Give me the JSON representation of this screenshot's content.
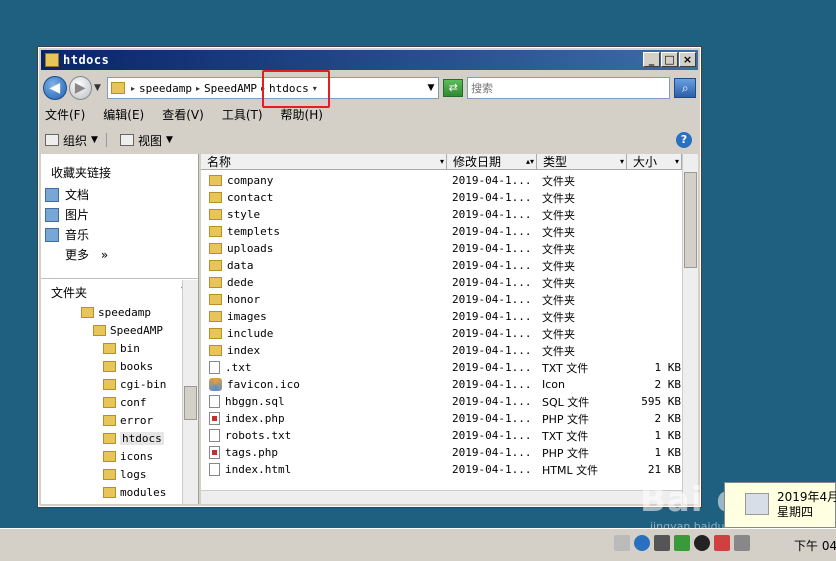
{
  "window": {
    "title": "htdocs"
  },
  "address": {
    "crumbs": [
      "speedamp",
      "SpeedAMP",
      "htdocs"
    ],
    "search_placeholder": "搜索"
  },
  "menu": [
    "文件(F)",
    "编辑(E)",
    "查看(V)",
    "工具(T)",
    "帮助(H)"
  ],
  "toolbar": {
    "organize": "组织",
    "view": "视图"
  },
  "favorites": {
    "title": "收藏夹链接",
    "items": [
      "文档",
      "图片",
      "音乐"
    ],
    "more": "更多",
    "more_arrow": "»"
  },
  "folders": {
    "title": "文件夹",
    "tree": [
      {
        "label": "speedamp"
      },
      {
        "label": "SpeedAMP"
      },
      {
        "label": "bin"
      },
      {
        "label": "books"
      },
      {
        "label": "cgi-bin"
      },
      {
        "label": "conf"
      },
      {
        "label": "error"
      },
      {
        "label": "htdocs",
        "selected": true
      },
      {
        "label": "icons"
      },
      {
        "label": "logs"
      },
      {
        "label": "modules"
      }
    ]
  },
  "columns": [
    "名称",
    "修改日期",
    "类型",
    "大小"
  ],
  "files": [
    {
      "name": "company",
      "date": "2019-04-1...",
      "type": "文件夹",
      "size": "",
      "icon": "folder-icon"
    },
    {
      "name": "contact",
      "date": "2019-04-1...",
      "type": "文件夹",
      "size": "",
      "icon": "folder-icon"
    },
    {
      "name": "style",
      "date": "2019-04-1...",
      "type": "文件夹",
      "size": "",
      "icon": "folder-icon"
    },
    {
      "name": "templets",
      "date": "2019-04-1...",
      "type": "文件夹",
      "size": "",
      "icon": "folder-icon"
    },
    {
      "name": "uploads",
      "date": "2019-04-1...",
      "type": "文件夹",
      "size": "",
      "icon": "folder-icon"
    },
    {
      "name": "data",
      "date": "2019-04-1...",
      "type": "文件夹",
      "size": "",
      "icon": "folder-icon"
    },
    {
      "name": "dede",
      "date": "2019-04-1...",
      "type": "文件夹",
      "size": "",
      "icon": "folder-icon"
    },
    {
      "name": "honor",
      "date": "2019-04-1...",
      "type": "文件夹",
      "size": "",
      "icon": "folder-icon"
    },
    {
      "name": "images",
      "date": "2019-04-1...",
      "type": "文件夹",
      "size": "",
      "icon": "folder-icon"
    },
    {
      "name": "include",
      "date": "2019-04-1...",
      "type": "文件夹",
      "size": "",
      "icon": "folder-icon"
    },
    {
      "name": "index",
      "date": "2019-04-1...",
      "type": "文件夹",
      "size": "",
      "icon": "folder-icon"
    },
    {
      "name": ".txt",
      "date": "2019-04-1...",
      "type": "TXT 文件",
      "size": "1 KB",
      "icon": "text-file-icon"
    },
    {
      "name": "favicon.ico",
      "date": "2019-04-1...",
      "type": "Icon",
      "size": "2 KB",
      "icon": "ico-file-icon"
    },
    {
      "name": "hbggn.sql",
      "date": "2019-04-1...",
      "type": "SQL 文件",
      "size": "595 KB",
      "icon": "text-file-icon"
    },
    {
      "name": "index.php",
      "date": "2019-04-1...",
      "type": "PHP 文件",
      "size": "2 KB",
      "icon": "php-file-icon"
    },
    {
      "name": "robots.txt",
      "date": "2019-04-1...",
      "type": "TXT 文件",
      "size": "1 KB",
      "icon": "text-file-icon"
    },
    {
      "name": "tags.php",
      "date": "2019-04-1...",
      "type": "PHP 文件",
      "size": "1 KB",
      "icon": "php-file-icon"
    },
    {
      "name": "index.html",
      "date": "2019-04-1...",
      "type": "HTML 文件",
      "size": "21 KB",
      "icon": "text-file-icon"
    }
  ],
  "taskbar": {
    "clock": "下午 04"
  },
  "tooltip": {
    "line1": "2019年4月1",
    "line2": "星期四"
  },
  "watermark": {
    "text": "Bai du",
    "sub": "jingyan.baidu.com"
  }
}
